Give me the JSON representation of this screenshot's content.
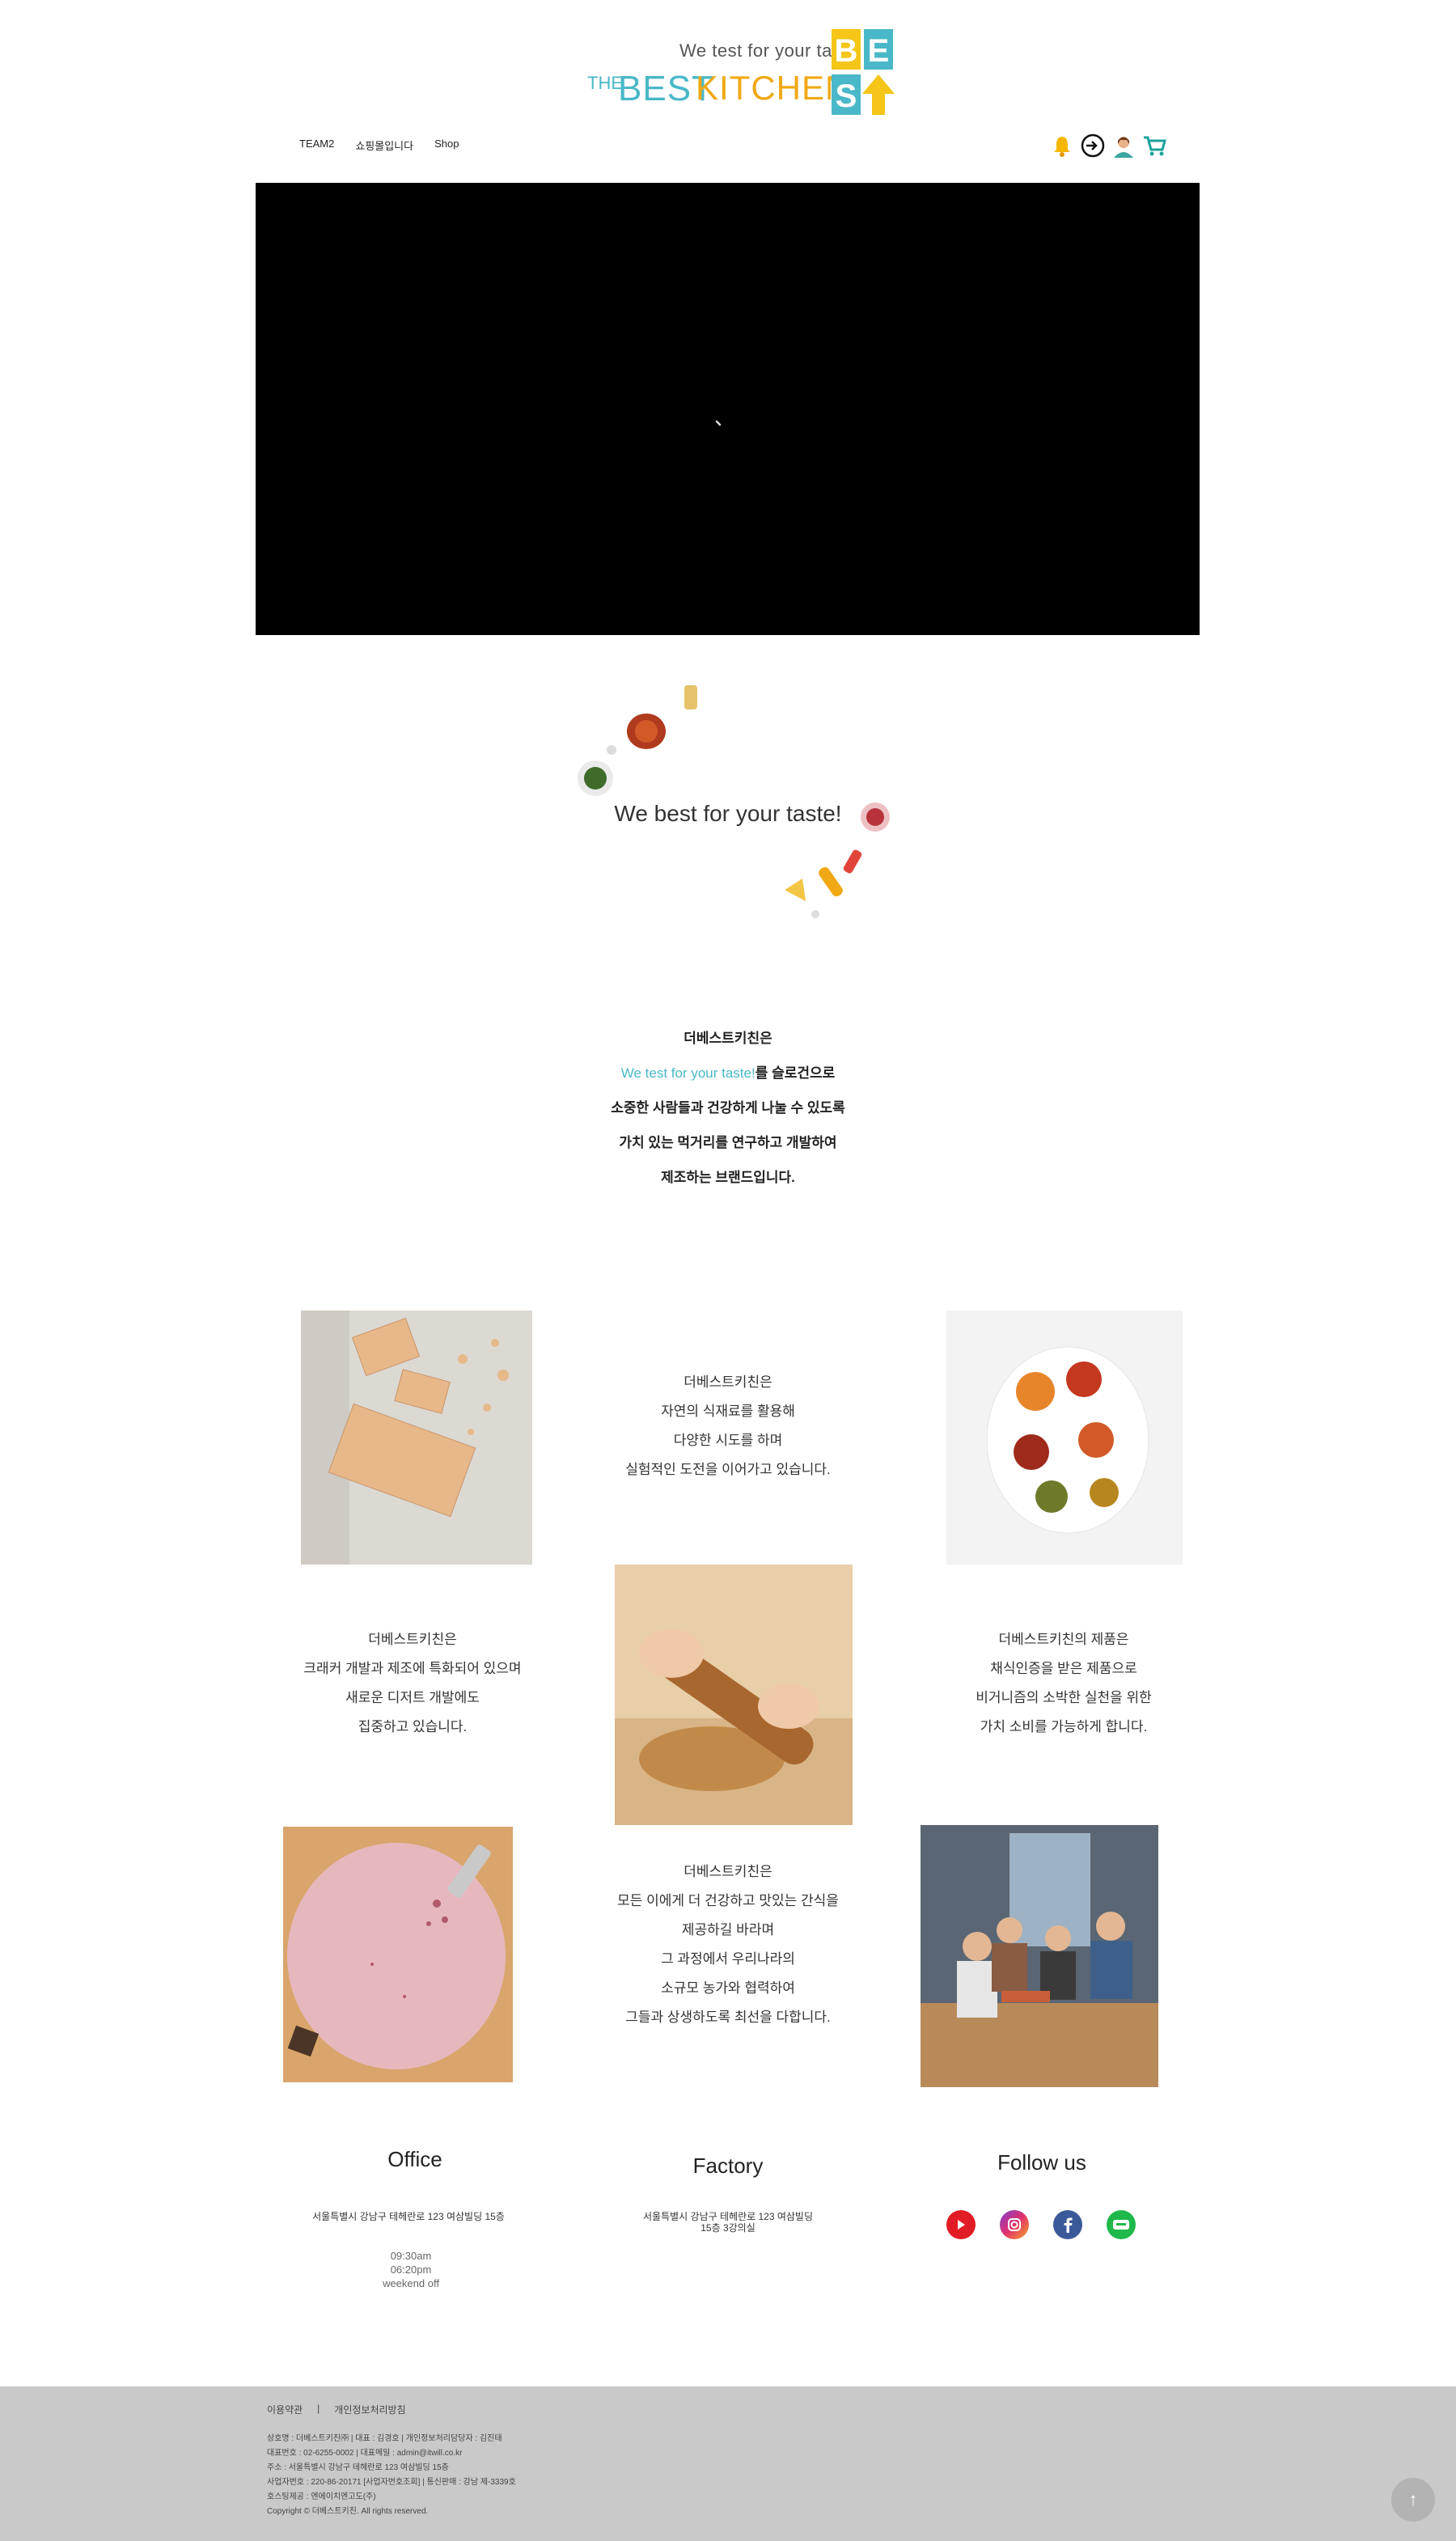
{
  "header": {
    "logo": {
      "tagline": "We test for your taste",
      "the": "THE",
      "best": "BEST",
      "kitchen": "KITCHEN",
      "block_letters": [
        "B",
        "E",
        "S",
        "T"
      ],
      "colors": {
        "teal": "#49b8c8",
        "orange": "#f0a814",
        "yellow": "#f5c518"
      }
    },
    "nav": [
      "TEAM2",
      "쇼핑몰입니다",
      "Shop"
    ],
    "icons": [
      "bell-icon",
      "login-icon",
      "user-icon",
      "cart-icon"
    ]
  },
  "hero": {
    "slogan": "We best for your taste!"
  },
  "brand_intro": {
    "line1": "더베스트키친은",
    "line2_highlight": "We test for your taste!",
    "line2_rest": "를 슬로건으로",
    "line3": "소중한 사람들과 건강하게 나눌 수 있도록",
    "line4": "가치 있는 먹거리를 연구하고 개발하여",
    "line5": "제조하는 브랜드입니다."
  },
  "paragraphs": {
    "p1": [
      "더베스트키친은",
      "자연의 식재료를 활용해",
      "다양한 시도를 하며",
      "실험적인 도전을 이어가고 있습니다."
    ],
    "p2": [
      "더베스트키친은",
      "크래커 개발과 제조에 특화되어 있으며",
      "새로운 디저트 개발에도",
      "집중하고 있습니다."
    ],
    "p3": [
      "더베스트키친의 제품은",
      "채식인증을 받은 제품으로",
      "비거니즘의 소박한 실천을 위한",
      "가치 소비를 가능하게 합니다."
    ],
    "p4": [
      "더베스트키친은",
      "모든 이에게 더 건강하고 맛있는 간식을",
      "제공하길 바라며",
      "그 과정에서 우리나라의",
      "소규모 농가와 협력하여",
      "그들과 상생하도록 최선을 다합니다."
    ]
  },
  "info": {
    "office": {
      "title": "Office",
      "address": "서울특별시 강남구 테헤란로 123 여삼빌딩 15층",
      "hours": [
        "09:30am",
        "06:20pm",
        "weekend off"
      ]
    },
    "factory": {
      "title": "Factory",
      "address": [
        "서울특별시 강남구 테헤란로 123 여삼빌딩",
        "15층 3강의실"
      ]
    },
    "follow": {
      "title": "Follow us",
      "icons": [
        "youtube-icon",
        "instagram-icon",
        "facebook-icon",
        "blog-icon"
      ]
    }
  },
  "footer": {
    "links": [
      "이용약관",
      "|",
      "개인정보처리방침"
    ],
    "lines": [
      "상호명 : 더베스트키친㈜   |   대표 : 김경호   |   개인정보처리담당자 : 김진태",
      "대표번호 : 02-6255-0002   |   대표메일 : admin@itwill.co.kr",
      "주소 : 서울특별시 강남구 테헤란로 123 여삼빌딩 15층",
      "사업자번호 : 220-86-20171 [사업자번호조회]   |   통신판매 : 강남 제-3339호",
      "호스팅제공 : 엔에이치엔고도(주)",
      "Copyright © 더베스트키친. All rights reserved."
    ],
    "top_button": "↑"
  }
}
